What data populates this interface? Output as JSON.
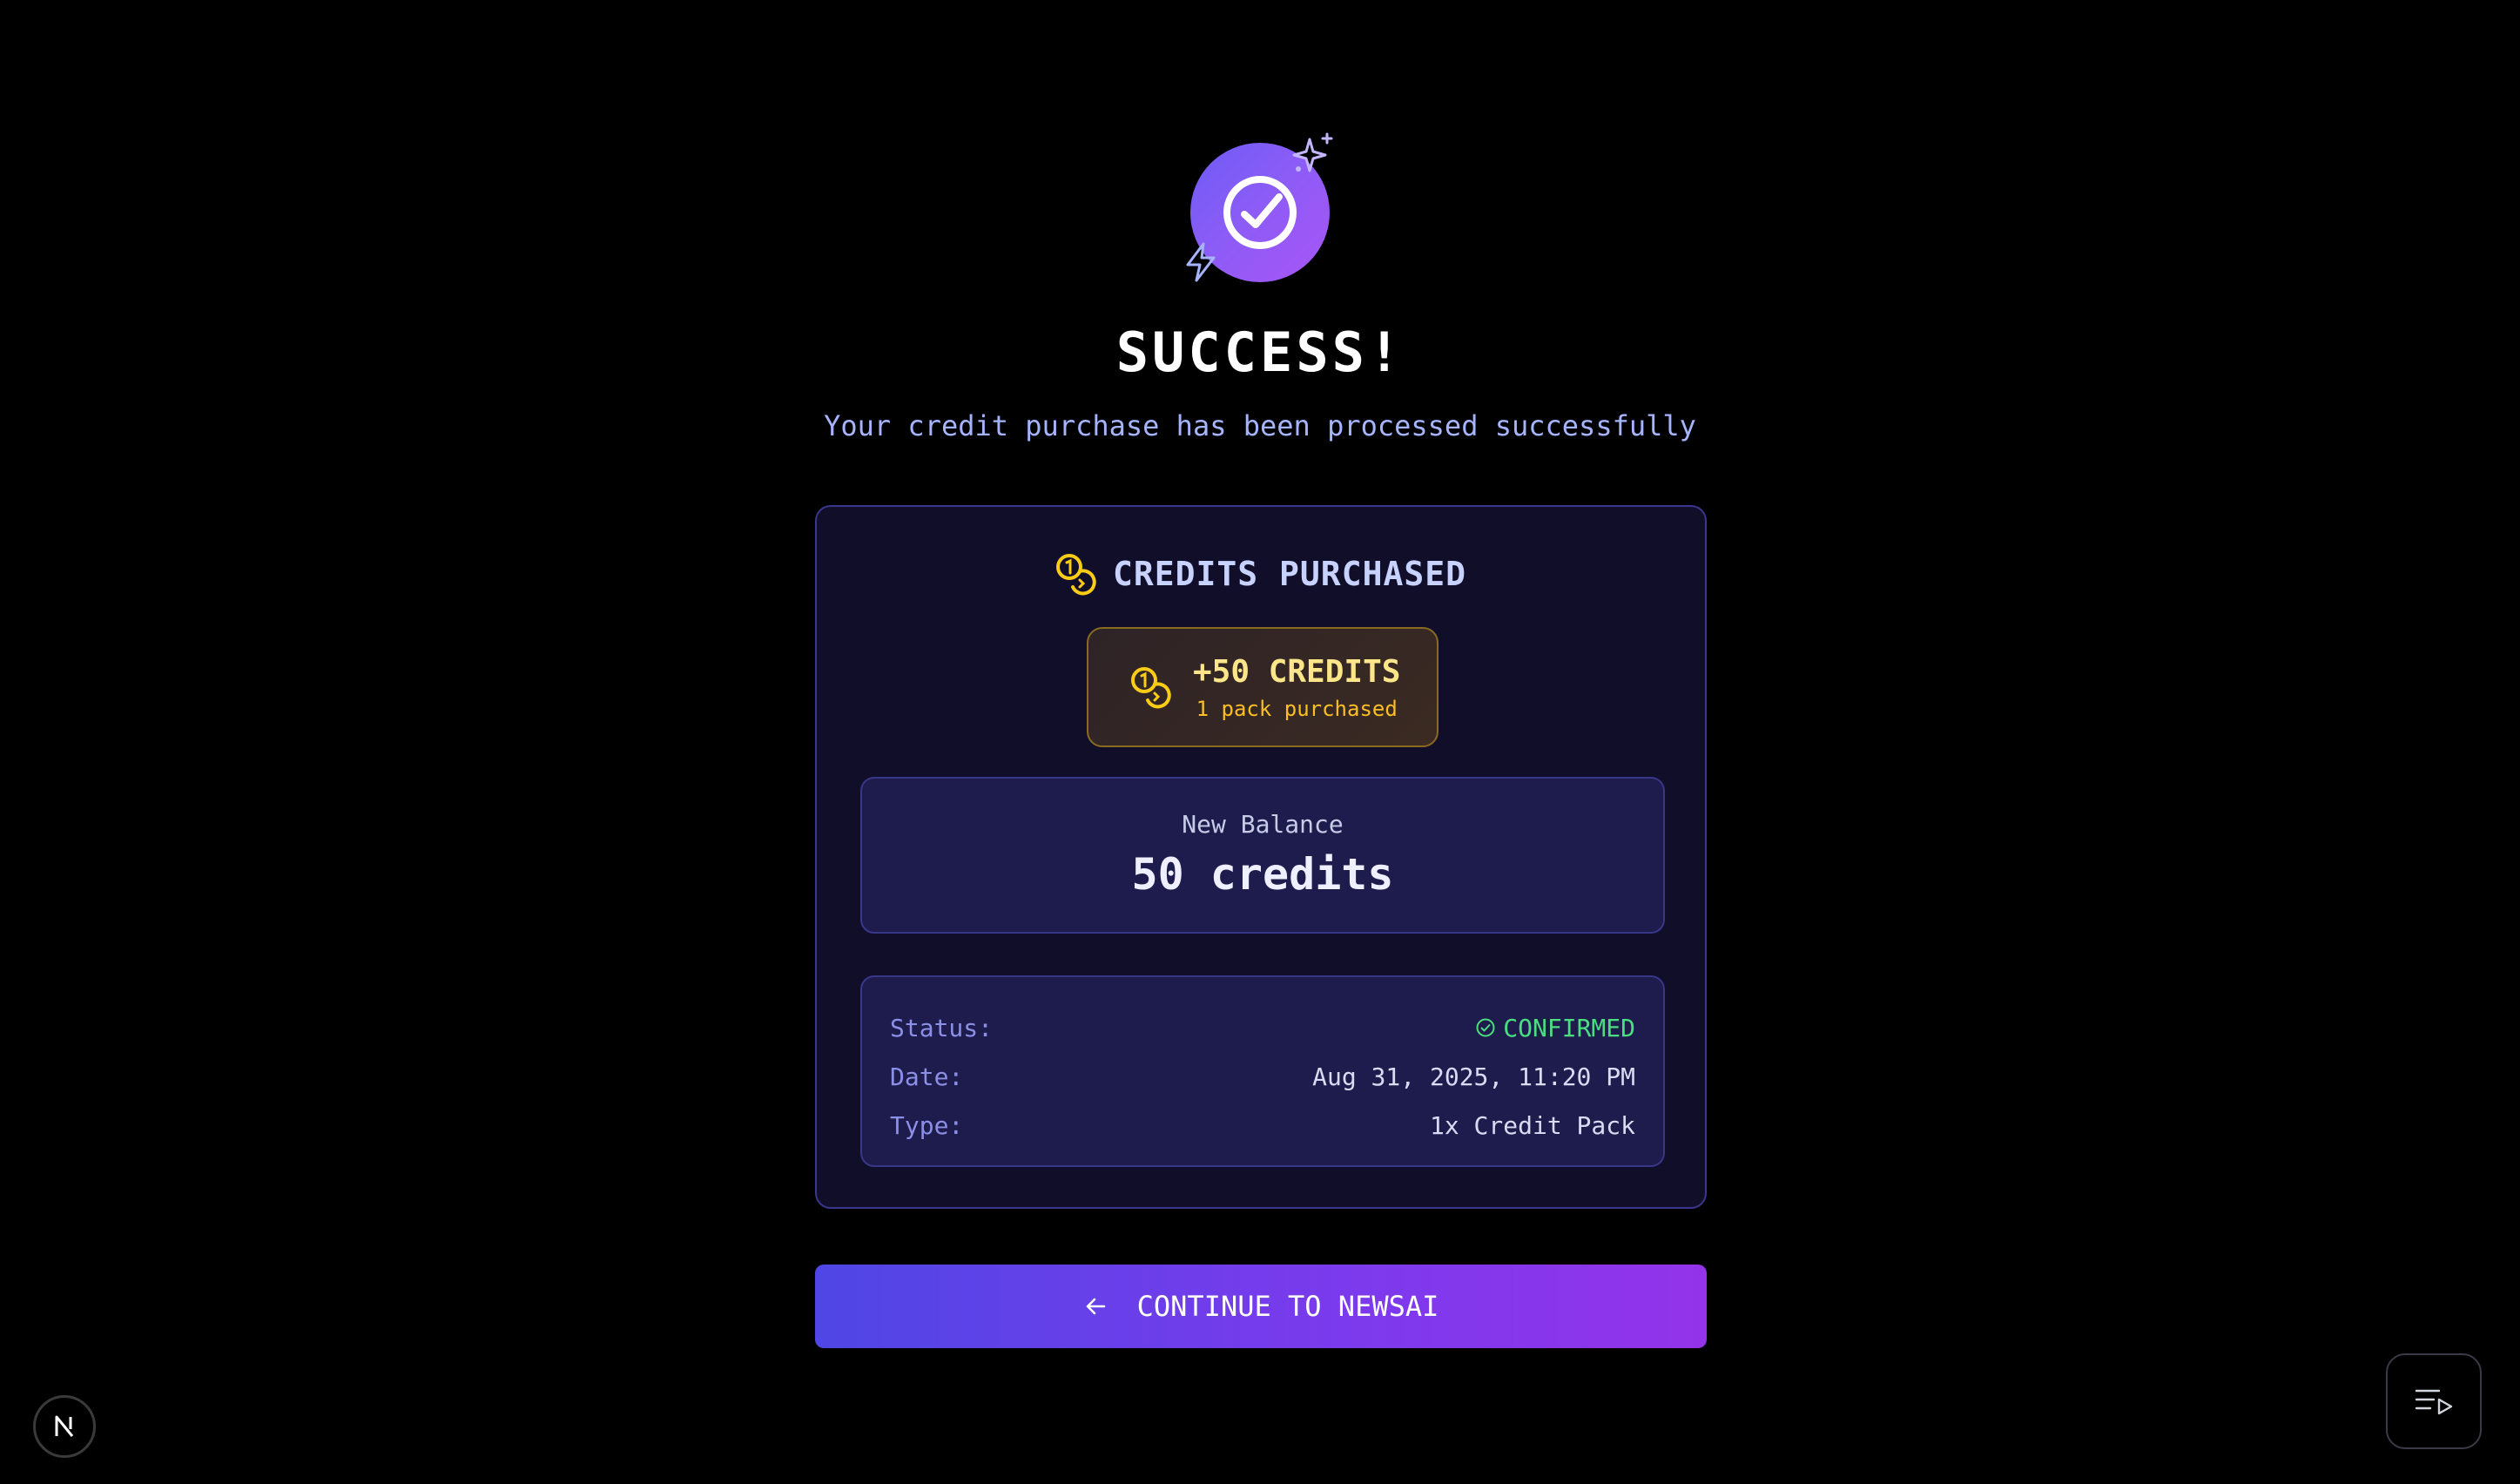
{
  "hero": {
    "icon": "check-circle-icon",
    "decorations": [
      "sparkle-icon",
      "bolt-icon"
    ],
    "title": "SUCCESS!",
    "subtitle": "Your credit purchase has been processed successfully"
  },
  "card": {
    "header_icon": "coins-icon",
    "header_label": "CREDITS PURCHASED",
    "badge": {
      "icon": "coins-icon",
      "amount": "+50 CREDITS",
      "pack_text": "1 pack purchased"
    },
    "balance": {
      "label": "New Balance",
      "value": "50 credits"
    },
    "details": [
      {
        "key": "Status:",
        "value": "CONFIRMED",
        "icon": "check-circle-icon"
      },
      {
        "key": "Date:",
        "value": "Aug 31, 2025, 11:20 PM"
      },
      {
        "key": "Type:",
        "value": "1x Credit Pack"
      }
    ]
  },
  "continue_button": {
    "icon": "arrow-left-icon",
    "label": "CONTINUE TO NEWSAI"
  },
  "corner": {
    "left_badge_letter": "N",
    "right_button_icon": "playlist-icon"
  },
  "colors": {
    "accent_start": "#4f46e5",
    "accent_end": "#9333ea",
    "gold": "#fbbf24",
    "success": "#4ade80",
    "card_bg": "#110e29"
  }
}
